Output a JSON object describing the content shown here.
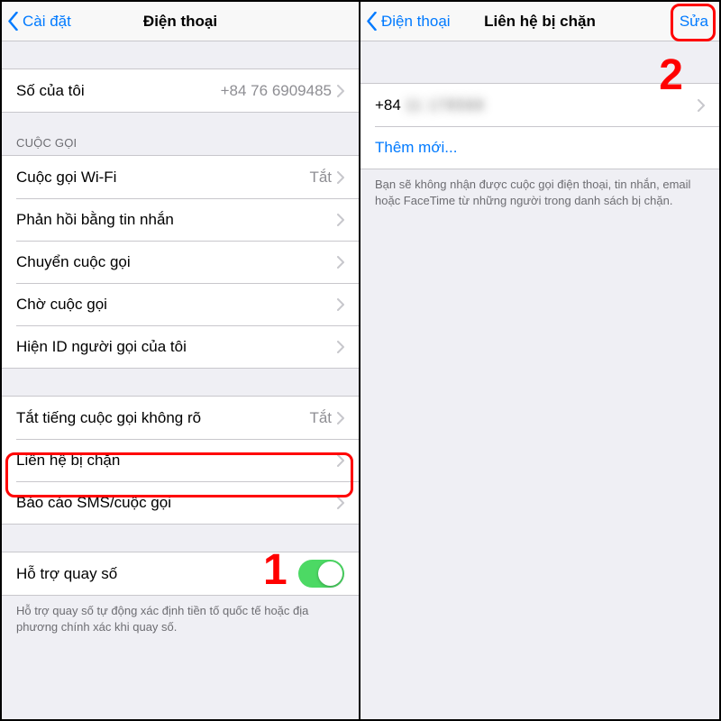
{
  "left": {
    "nav_back": "Cài đặt",
    "nav_title": "Điện thoại",
    "my_number_label": "Số của tôi",
    "my_number_value": "+84 76 6909485",
    "section_calls": "CUỘC GỌI",
    "rows": {
      "wifi_call": "Cuộc gọi Wi-Fi",
      "wifi_call_value": "Tắt",
      "respond_msg": "Phản hồi bằng tin nhắn",
      "call_fwd": "Chuyển cuộc gọi",
      "call_wait": "Chờ cuộc gọi",
      "caller_id": "Hiện ID người gọi của tôi",
      "silence_unknown": "Tắt tiếng cuộc gọi không rõ",
      "silence_unknown_value": "Tắt",
      "blocked_contacts": "Liên hệ bị chặn",
      "sms_report": "Báo cáo SMS/cuộc gọi",
      "dial_assist": "Hỗ trợ quay số"
    },
    "dial_assist_footnote": "Hỗ trợ quay số tự động xác định tiền tố quốc tế hoặc địa phương chính xác khi quay số.",
    "step_num": "1"
  },
  "right": {
    "nav_back": "Điện thoại",
    "nav_title": "Liên hệ bị chặn",
    "nav_edit": "Sửa",
    "blocked_entry_prefix": "+84",
    "blocked_entry_blur": "11 178568",
    "add_new": "Thêm mới...",
    "footnote": "Bạn sẽ không nhận được cuộc gọi điện thoại, tin nhắn, email hoặc FaceTime từ những người trong danh sách bị chặn.",
    "step_num": "2"
  }
}
